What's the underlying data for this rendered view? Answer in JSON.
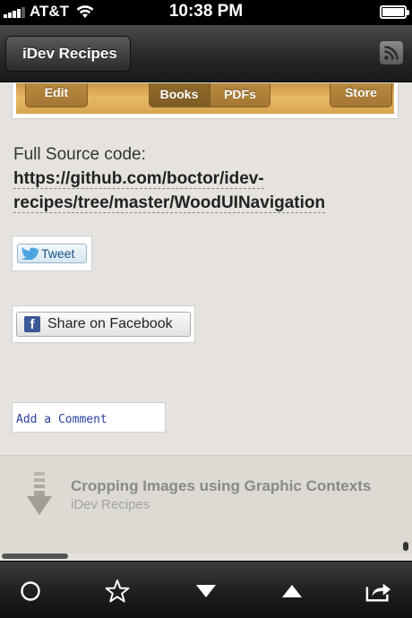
{
  "status_bar": {
    "carrier": "AT&T",
    "time": "10:38 PM"
  },
  "nav": {
    "back_label": "iDev Recipes",
    "rss_icon": "rss-icon"
  },
  "wood_toolbar": {
    "edit": "Edit",
    "books": "Books",
    "pdfs": "PDFs",
    "store": "Store"
  },
  "content": {
    "source_prefix": "Full Source code: ",
    "source_link": "https://github.com/boctor/idev-recipes/tree/master/WoodUINavigation",
    "tweet_label": "Tweet",
    "facebook_label": "Share on Facebook",
    "comment_label": "Add a Comment"
  },
  "next_article": {
    "title": "Cropping Images using Graphic Contexts",
    "source": "iDev Recipes"
  },
  "toolbar": {
    "icons": [
      "circle-icon",
      "star-icon",
      "down-arrow-icon",
      "up-arrow-icon",
      "share-icon"
    ]
  },
  "colors": {
    "background": "#e6e3de",
    "wood": "#e8b964",
    "link": "#2a3fa0",
    "facebook": "#3b5998"
  }
}
